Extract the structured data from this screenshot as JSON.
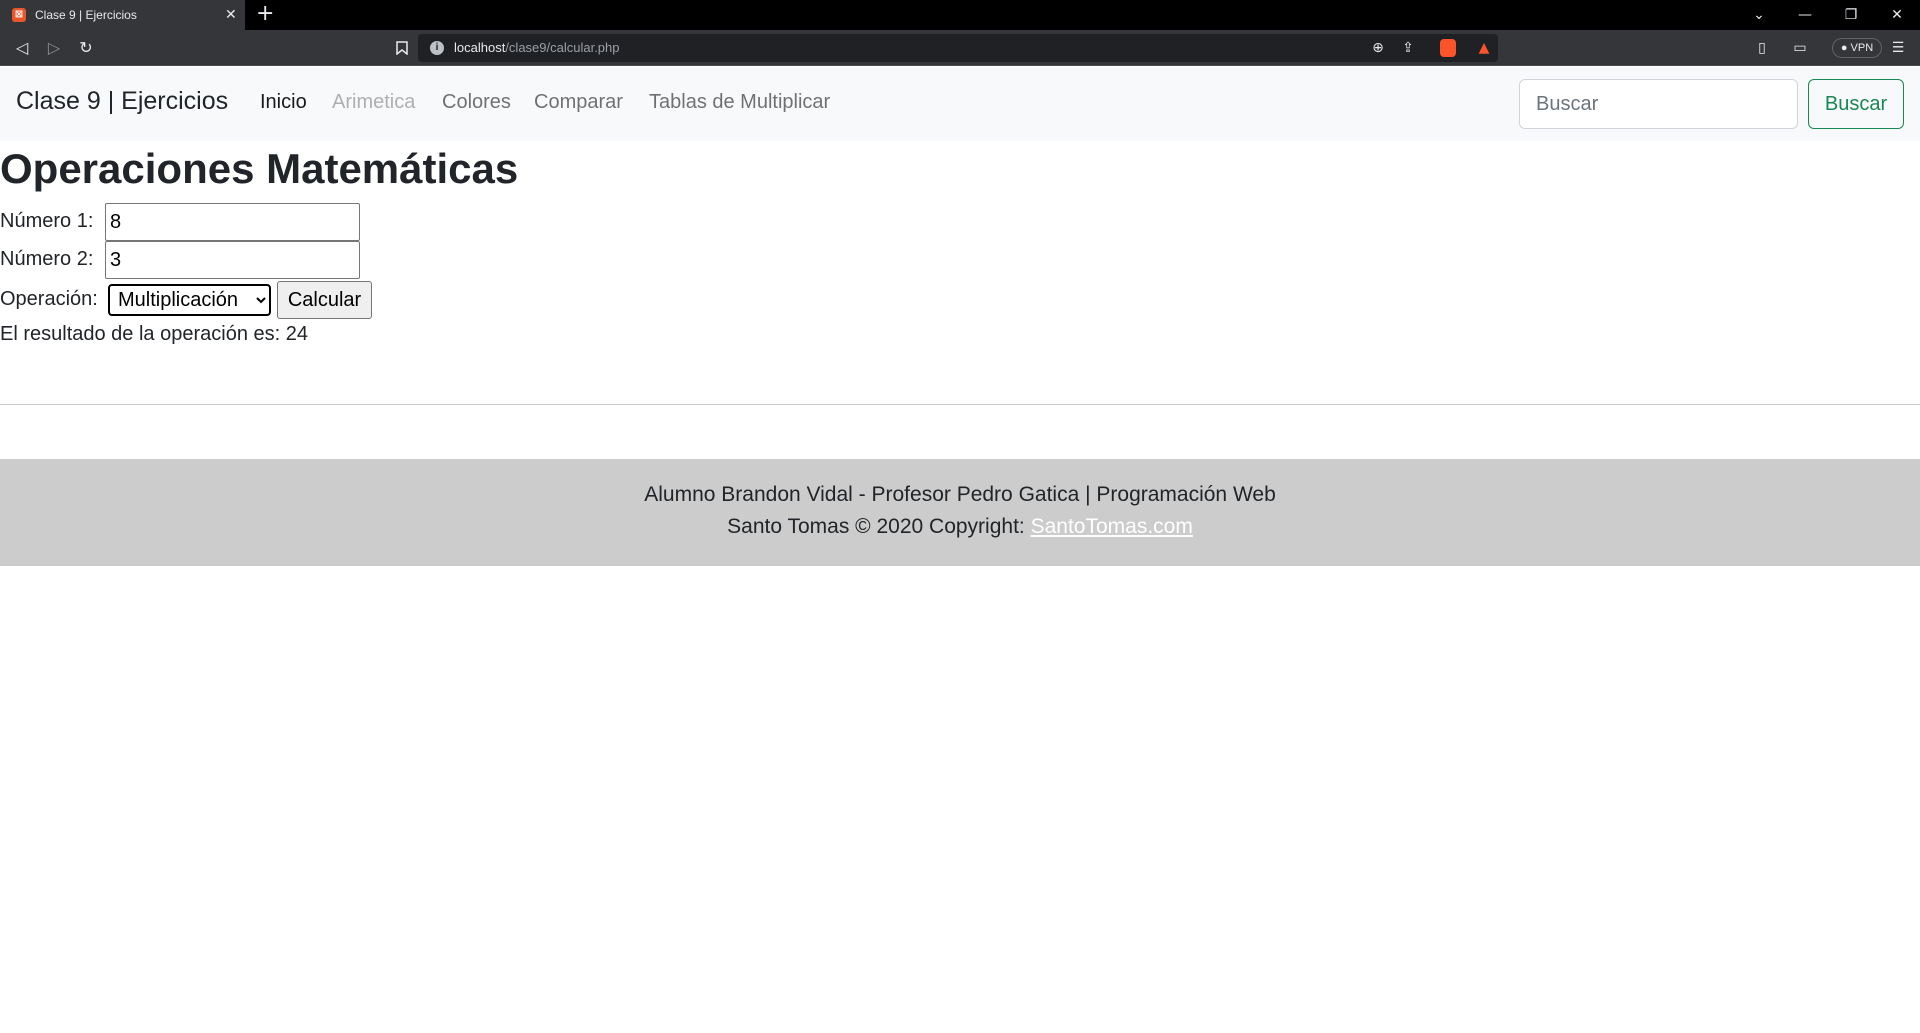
{
  "browser": {
    "tab_title": "Clase 9 | Ejercicios",
    "tab_close": "✕",
    "new_tab": "+",
    "url_host": "localhost",
    "url_path": "/clase9/calcular.php",
    "vpn_label": "VPN"
  },
  "navbar": {
    "brand": "Clase 9 | Ejercicios",
    "links": [
      {
        "label": "Inicio",
        "state": "active"
      },
      {
        "label": "Arimetica",
        "state": "disabled"
      },
      {
        "label": "Colores",
        "state": "normal"
      },
      {
        "label": "Comparar",
        "state": "normal"
      },
      {
        "label": "Tablas de Multiplicar",
        "state": "normal"
      }
    ],
    "search_placeholder": "Buscar",
    "search_button": "Buscar"
  },
  "main": {
    "heading": "Operaciones Matemáticas",
    "num1_label": "Número 1:",
    "num1_value": "8",
    "num2_label": "Número 2:",
    "num2_value": "3",
    "op_label": "Operación:",
    "op_selected": "Multiplicación",
    "calc_button": "Calcular",
    "result_text": "El resultado de la operación es: 24"
  },
  "footer": {
    "line1": "Alumno Brandon Vidal - Profesor Pedro Gatica | Programación Web",
    "line2_prefix": "Santo Tomas © 2020 Copyright: ",
    "line2_link": "SantoTomas.com"
  },
  "colors": {
    "navbar_bg": "#f8f9fa",
    "success": "#198754",
    "footer_bg": "#cccccc"
  }
}
